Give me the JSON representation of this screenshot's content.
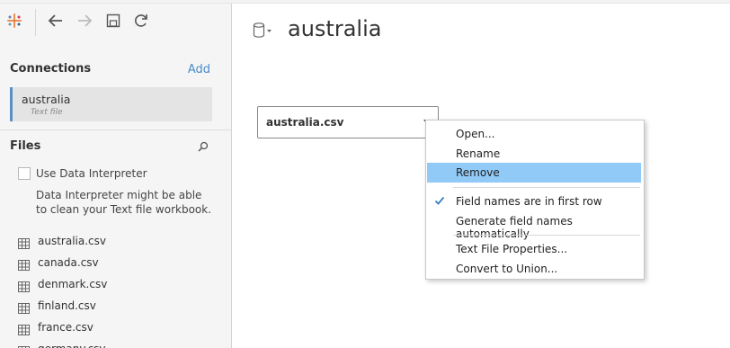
{
  "left_panel": {
    "connections_title": "Connections",
    "add_label": "Add",
    "connection": {
      "name": "australia",
      "type": "Text file"
    },
    "files_title": "Files",
    "interpreter": {
      "label": "Use Data Interpreter",
      "checked": false,
      "description": "Data Interpreter might be able to clean your Text file workbook."
    },
    "files": [
      {
        "name": "australia.csv"
      },
      {
        "name": "canada.csv"
      },
      {
        "name": "denmark.csv"
      },
      {
        "name": "finland.csv"
      },
      {
        "name": "france.csv"
      },
      {
        "name": "germany.csv"
      }
    ]
  },
  "main": {
    "title": "australia",
    "table_pill": "australia.csv"
  },
  "context_menu": {
    "items": [
      {
        "label": "Open...",
        "checked": false,
        "highlighted": false
      },
      {
        "label": "Rename",
        "checked": false,
        "highlighted": false
      },
      {
        "label": "Remove",
        "checked": false,
        "highlighted": true
      },
      {
        "label": "Field names are in first row",
        "checked": true,
        "highlighted": false
      },
      {
        "label": "Generate field names automatically",
        "checked": false,
        "highlighted": false
      },
      {
        "label": "Text File Properties...",
        "checked": false,
        "highlighted": false
      },
      {
        "label": "Convert to Union...",
        "checked": false,
        "highlighted": false
      }
    ]
  },
  "colors": {
    "accent": "#4a8bc9",
    "menu_highlight": "#91c9f7",
    "panel_bg": "#f5f5f5",
    "selected_connection_bg": "#e4e4e4",
    "selected_connection_border": "#5a8fc0",
    "check_mark": "#3a7fc0"
  },
  "icons": {
    "logo": "tableau-logo-icon",
    "back": "back-arrow-icon",
    "forward": "forward-arrow-icon",
    "save": "save-icon",
    "refresh": "refresh-icon",
    "search": "search-icon",
    "file": "table-grid-icon",
    "datasource": "database-icon"
  }
}
